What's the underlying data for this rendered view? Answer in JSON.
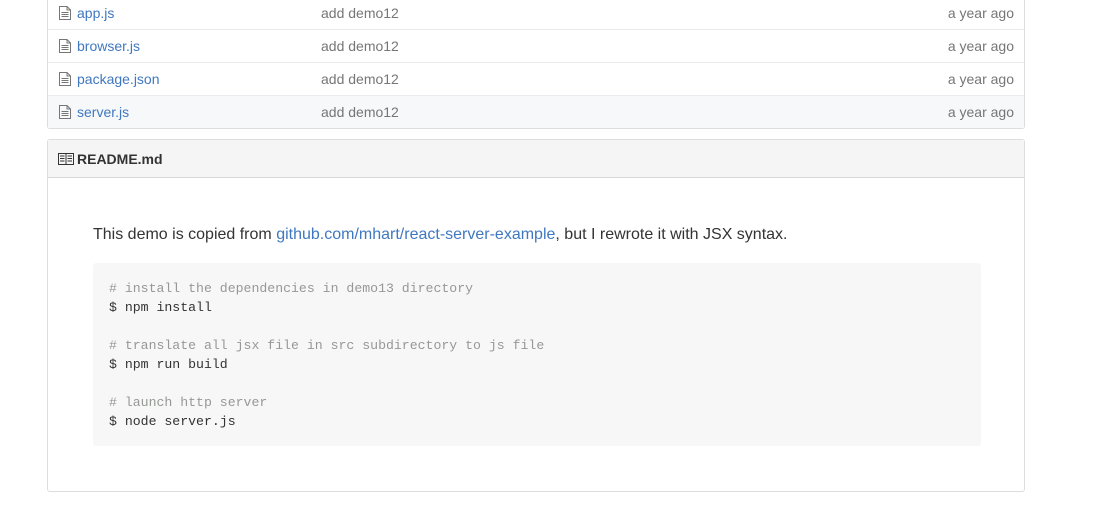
{
  "files": [
    {
      "name": "app.js",
      "message": "add demo12",
      "age": "a year ago"
    },
    {
      "name": "browser.js",
      "message": "add demo12",
      "age": "a year ago"
    },
    {
      "name": "package.json",
      "message": "add demo12",
      "age": "a year ago"
    },
    {
      "name": "server.js",
      "message": "add demo12",
      "age": "a year ago"
    }
  ],
  "readme": {
    "title": "README.md",
    "text_before": "This demo is copied from ",
    "link_text": "github.com/mhart/react-server-example",
    "text_after": ", but I rewrote it with JSX syntax.",
    "code": [
      {
        "comment": "# install the dependencies in demo13 directory",
        "command": "$ npm install"
      },
      {
        "comment": "# translate all jsx file in src subdirectory to js file",
        "command": "$ npm run build"
      },
      {
        "comment": "# launch http server",
        "command": "$ node server.js"
      }
    ]
  },
  "colors": {
    "link": "#4078c0",
    "muted": "#767676",
    "code_bg": "#f7f7f7",
    "header_bg": "#f5f5f5"
  }
}
